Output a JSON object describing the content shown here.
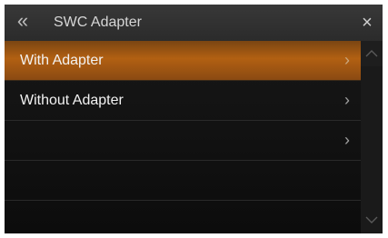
{
  "header": {
    "back_glyph": "«",
    "title": "SWC Adapter",
    "close_glyph": "×"
  },
  "list": {
    "items": [
      {
        "label": "With Adapter",
        "selected": true,
        "has_arrow": true
      },
      {
        "label": "Without Adapter",
        "selected": false,
        "has_arrow": true
      },
      {
        "label": "",
        "selected": false,
        "has_arrow": true
      },
      {
        "label": "",
        "selected": false,
        "has_arrow": false
      },
      {
        "label": "",
        "selected": false,
        "has_arrow": false
      }
    ],
    "chevron_glyph": "›"
  },
  "scrollbar": {
    "up_icon": "chevron-up-icon",
    "down_icon": "chevron-down-icon"
  },
  "colors": {
    "accent_selected": "#b26012",
    "background": "#0c0c0c",
    "header": "#333333"
  }
}
